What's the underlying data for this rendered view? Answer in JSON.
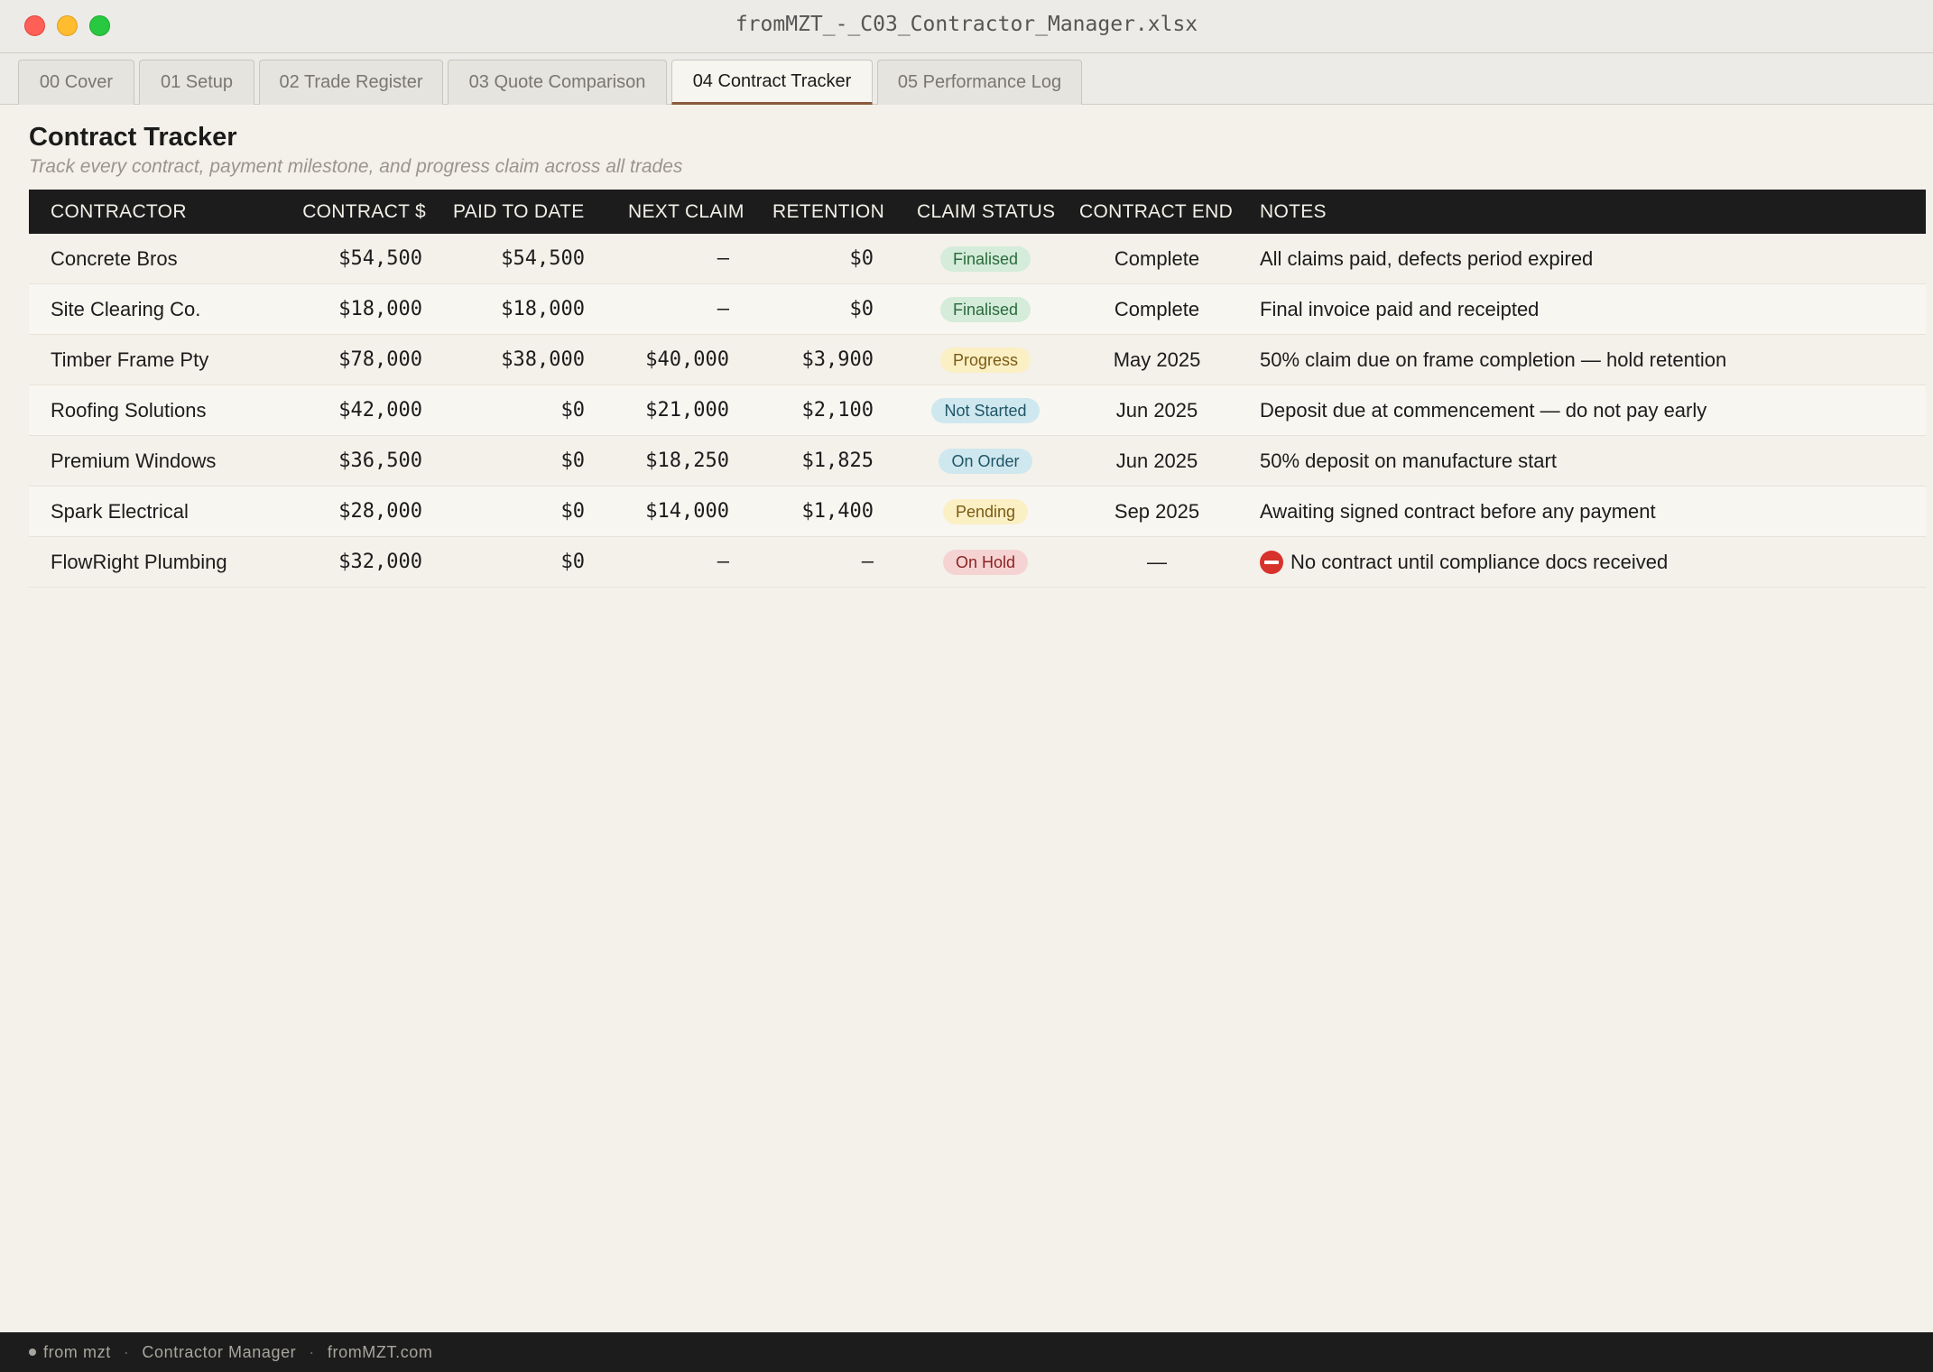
{
  "window": {
    "title": "fromMZT_-_C03_Contractor_Manager.xlsx"
  },
  "tabs": [
    {
      "label": "00 Cover",
      "active": false
    },
    {
      "label": "01 Setup",
      "active": false
    },
    {
      "label": "02 Trade Register",
      "active": false
    },
    {
      "label": "03 Quote Comparison",
      "active": false
    },
    {
      "label": "04 Contract Tracker",
      "active": true
    },
    {
      "label": "05 Performance Log",
      "active": false
    }
  ],
  "page": {
    "title": "Contract Tracker",
    "subtitle": "Track every contract, payment milestone, and progress claim across all trades"
  },
  "table": {
    "headers": {
      "contractor": "CONTRACTOR",
      "contract": "CONTRACT $",
      "paid": "PAID TO DATE",
      "next_claim": "NEXT CLAIM",
      "retention": "RETENTION",
      "claim_status": "CLAIM STATUS",
      "contract_end": "CONTRACT END",
      "notes": "NOTES"
    },
    "rows": [
      {
        "contractor": "Concrete Bros",
        "contract": "$54,500",
        "paid": "$54,500",
        "next_claim": "–",
        "retention": "$0",
        "status": "Finalised",
        "status_tone": "green",
        "end": "Complete",
        "notes": "All claims paid, defects period expired",
        "note_icon": ""
      },
      {
        "contractor": "Site Clearing Co.",
        "contract": "$18,000",
        "paid": "$18,000",
        "next_claim": "–",
        "retention": "$0",
        "status": "Finalised",
        "status_tone": "green",
        "end": "Complete",
        "notes": "Final invoice paid and receipted",
        "note_icon": ""
      },
      {
        "contractor": "Timber Frame Pty",
        "contract": "$78,000",
        "paid": "$38,000",
        "next_claim": "$40,000",
        "retention": "$3,900",
        "status": "Progress",
        "status_tone": "yellow",
        "end": "May 2025",
        "notes": "50% claim due on frame completion — hold retention",
        "note_icon": ""
      },
      {
        "contractor": "Roofing Solutions",
        "contract": "$42,000",
        "paid": "$0",
        "next_claim": "$21,000",
        "retention": "$2,100",
        "status": "Not Started",
        "status_tone": "blue",
        "end": "Jun 2025",
        "notes": "Deposit due at commencement — do not pay early",
        "note_icon": ""
      },
      {
        "contractor": "Premium Windows",
        "contract": "$36,500",
        "paid": "$0",
        "next_claim": "$18,250",
        "retention": "$1,825",
        "status": "On Order",
        "status_tone": "blue",
        "end": "Jun 2025",
        "notes": "50% deposit on manufacture start",
        "note_icon": ""
      },
      {
        "contractor": "Spark Electrical",
        "contract": "$28,000",
        "paid": "$0",
        "next_claim": "$14,000",
        "retention": "$1,400",
        "status": "Pending",
        "status_tone": "yellow",
        "end": "Sep 2025",
        "notes": "Awaiting signed contract before any payment",
        "note_icon": ""
      },
      {
        "contractor": "FlowRight Plumbing",
        "contract": "$32,000",
        "paid": "$0",
        "next_claim": "–",
        "retention": "–",
        "status": "On Hold",
        "status_tone": "red",
        "end": "—",
        "notes": "No contract until compliance docs received",
        "note_icon": "no-entry-icon"
      }
    ]
  },
  "status_colors": {
    "green": {
      "bg": "#d4ecd9",
      "fg": "#2b6a3c"
    },
    "yellow": {
      "bg": "#fbefc4",
      "fg": "#7a5b14"
    },
    "blue": {
      "bg": "#cfe8ef",
      "fg": "#1f5566"
    },
    "red": {
      "bg": "#f6d3d3",
      "fg": "#8c2222"
    }
  },
  "footer": {
    "brand": "from mzt",
    "product": "Contractor Manager",
    "site": "fromMZT.com"
  }
}
